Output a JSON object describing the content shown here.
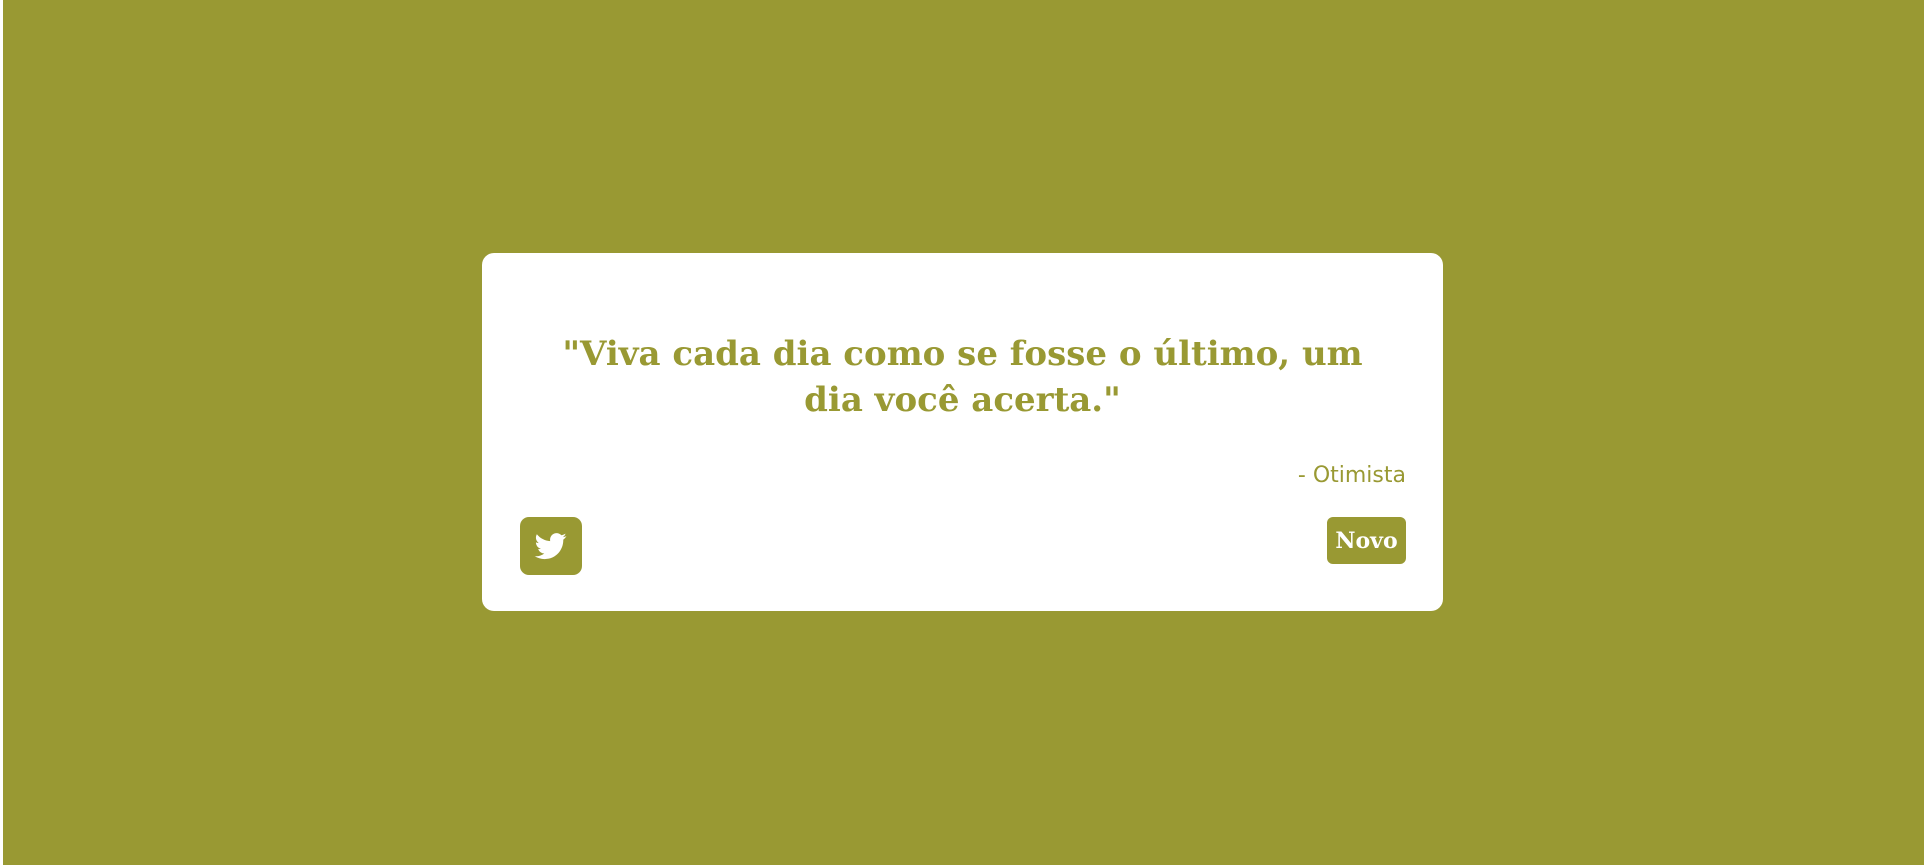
{
  "theme": {
    "accent_color": "#999933",
    "card_color": "#ffffff"
  },
  "quote": {
    "text": "\"Viva cada dia como se fosse o último, um dia você acerta.\"",
    "author": "- Otimista"
  },
  "actions": {
    "tweet_icon": "twitter-bird-icon",
    "new_label": "Novo"
  }
}
